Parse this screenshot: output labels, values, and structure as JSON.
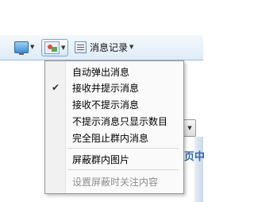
{
  "toolbar": {
    "items": [
      {
        "icon": "emoji-icon"
      },
      {
        "icon": "screen-icon"
      },
      {
        "icon": "image-icon"
      },
      {
        "icon": "message-icon",
        "label": "消息记录"
      }
    ]
  },
  "background_text": "页中",
  "menu": {
    "items": [
      {
        "label": "自动弹出消息",
        "checked": false,
        "enabled": true
      },
      {
        "label": "接收并提示消息",
        "checked": true,
        "enabled": true
      },
      {
        "label": "接收不提示消息",
        "checked": false,
        "enabled": true
      },
      {
        "label": "不提示消息只显示数目",
        "checked": false,
        "enabled": true
      },
      {
        "label": "完全阻止群内消息",
        "checked": false,
        "enabled": true
      },
      {
        "label": "屏蔽群内图片",
        "checked": false,
        "enabled": true
      },
      {
        "label": "设置屏蔽时关注内容",
        "checked": false,
        "enabled": false
      }
    ],
    "check_glyph": "✔",
    "dropdown_glyph": "▼"
  }
}
